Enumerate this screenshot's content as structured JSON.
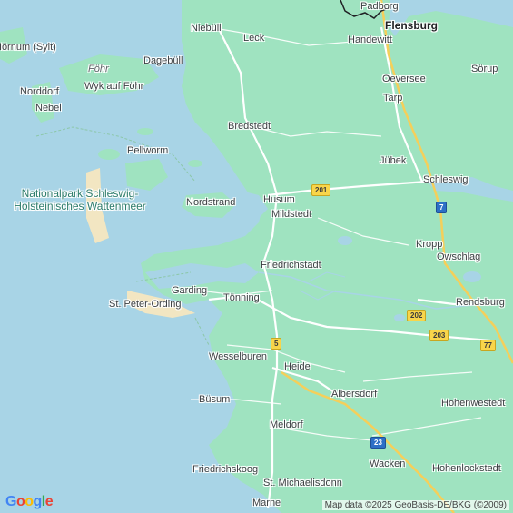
{
  "places": [
    {
      "id": "padborg",
      "name": "Padborg"
    },
    {
      "id": "flensburg",
      "name": "Flensburg"
    },
    {
      "id": "niebull",
      "name": "Niebüll"
    },
    {
      "id": "leck",
      "name": "Leck"
    },
    {
      "id": "handewitt",
      "name": "Handewitt"
    },
    {
      "id": "hornum",
      "name": "Hörnum (Sylt)"
    },
    {
      "id": "fohr",
      "name": "Föhr"
    },
    {
      "id": "dagebull",
      "name": "Dagebüll"
    },
    {
      "id": "oeversee",
      "name": "Oeversee"
    },
    {
      "id": "sorup",
      "name": "Sörup"
    },
    {
      "id": "norddorf",
      "name": "Norddorf"
    },
    {
      "id": "wyk",
      "name": "Wyk auf Föhr"
    },
    {
      "id": "nebel",
      "name": "Nebel"
    },
    {
      "id": "tarp",
      "name": "Tarp"
    },
    {
      "id": "bredstedt",
      "name": "Bredstedt"
    },
    {
      "id": "jubek",
      "name": "Jübek"
    },
    {
      "id": "pellworm",
      "name": "Pellworm"
    },
    {
      "id": "schleswig",
      "name": "Schleswig"
    },
    {
      "id": "nordstrand",
      "name": "Nordstrand"
    },
    {
      "id": "husum",
      "name": "Husum"
    },
    {
      "id": "mildstedt",
      "name": "Mildstedt"
    },
    {
      "id": "kropp",
      "name": "Kropp"
    },
    {
      "id": "owschlag",
      "name": "Owschlag"
    },
    {
      "id": "friedrichstadt",
      "name": "Friedrichstadt"
    },
    {
      "id": "garding",
      "name": "Garding"
    },
    {
      "id": "tonning",
      "name": "Tönning"
    },
    {
      "id": "stpeter",
      "name": "St. Peter-Ording"
    },
    {
      "id": "rendsburg",
      "name": "Rendsburg"
    },
    {
      "id": "wesselburen",
      "name": "Wesselburen"
    },
    {
      "id": "heide",
      "name": "Heide"
    },
    {
      "id": "albersdorf",
      "name": "Albersdorf"
    },
    {
      "id": "busum",
      "name": "Büsum"
    },
    {
      "id": "hohenwestedt",
      "name": "Hohenwestedt"
    },
    {
      "id": "meldorf",
      "name": "Meldorf"
    },
    {
      "id": "wacken",
      "name": "Wacken"
    },
    {
      "id": "friedrichskoog",
      "name": "Friedrichskoog"
    },
    {
      "id": "hohenlockstedt",
      "name": "Hohenlockstedt"
    },
    {
      "id": "stmichaelisdonn",
      "name": "St. Michaelisdonn"
    },
    {
      "id": "marne",
      "name": "Marne"
    }
  ],
  "park_label": "Nationalpark Schleswig-Holsteinisches Wattenmeer",
  "road_shields": {
    "b201": "201",
    "a7": "7",
    "b202": "202",
    "b203": "203",
    "a77": "77",
    "b5": "5",
    "a23": "23"
  },
  "attribution": "Map data ©2025 GeoBasis-DE/BKG (©2009)",
  "logo": {
    "text": "Google",
    "colors": [
      "#4285f4",
      "#ea4335",
      "#fbbc05",
      "#4285f4",
      "#34a853",
      "#ea4335"
    ]
  },
  "colors": {
    "water": "#a8d4e6",
    "land": "#9fe3c0",
    "road": "#ffffff",
    "motorway": "#f5cf5a",
    "border": "#202124"
  }
}
